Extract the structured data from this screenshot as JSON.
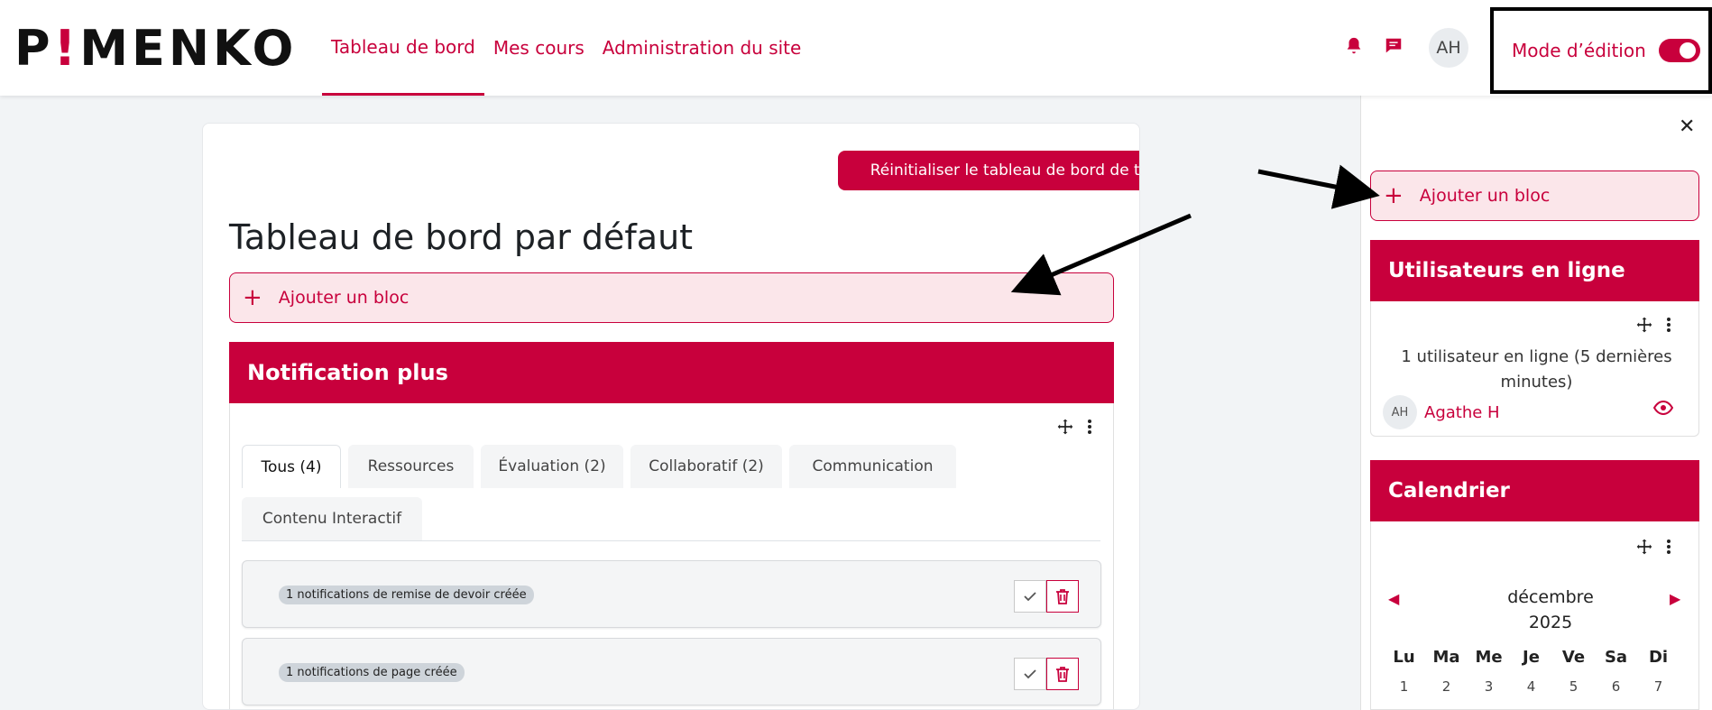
{
  "header": {
    "logo_left": "P",
    "logo_bang": "!",
    "logo_right": "MENKO",
    "nav": [
      "Tableau de bord",
      "Mes cours",
      "Administration du site"
    ],
    "avatar_initials": "AH",
    "edit_mode_label": "Mode d’édition",
    "edit_mode_on": true
  },
  "main": {
    "reset_button": "Réinitialiser le tableau de bord de tous les utilisateurs",
    "title": "Tableau de bord par défaut",
    "add_block_label": "Ajouter un bloc",
    "notif_block": {
      "title": "Notification plus",
      "tabs": [
        "Tous (4)",
        "Ressources",
        "Évaluation (2)",
        "Collaboratif (2)",
        "Communication",
        "Contenu Interactif"
      ],
      "active_tab": "Tous (4)",
      "notifications": [
        "1 notifications de remise de devoir créée",
        "1 notifications de page créée"
      ]
    }
  },
  "drawer": {
    "add_block_label": "Ajouter un bloc",
    "online_block": {
      "title": "Utilisateurs en ligne",
      "summary": "1 utilisateur en ligne (5 dernières minutes)",
      "user_initials": "AH",
      "user_name": "Agathe H"
    },
    "calendar": {
      "title": "Calendrier",
      "month": "décembre",
      "year": "2025",
      "days": [
        "Lu",
        "Ma",
        "Me",
        "Je",
        "Ve",
        "Sa",
        "Di"
      ],
      "first_week": [
        "1",
        "2",
        "3",
        "4",
        "5",
        "6",
        "7"
      ]
    }
  },
  "colors": {
    "accent": "#c8003c",
    "accent_light": "#fbe6ea"
  }
}
